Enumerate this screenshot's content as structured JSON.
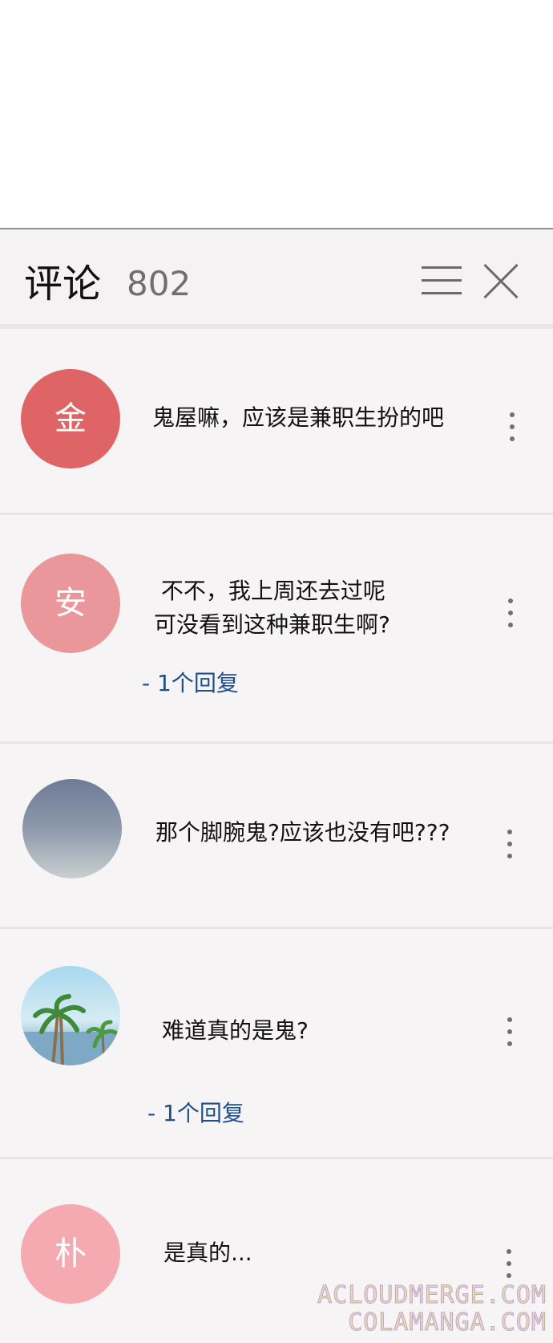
{
  "header": {
    "title": "评论",
    "count": "802"
  },
  "comments": [
    {
      "avatar_text": "金",
      "avatar_color": "#df6466",
      "text": "鬼屋嘛，应该是兼职生扮的吧",
      "reply": ""
    },
    {
      "avatar_text": "安",
      "avatar_color": "#e9979a",
      "text": " 不不，我上周还去过呢\n可没看到这种兼职生啊?",
      "reply": "- 1个回复"
    },
    {
      "avatar_text": "",
      "avatar_color": "#8f9cb2",
      "text": "那个脚腕鬼?应该也没有吧???",
      "reply": ""
    },
    {
      "avatar_text": "",
      "avatar_color": "#9ed0ea",
      "text": "难道真的是鬼?",
      "reply": "-  1个回复"
    },
    {
      "avatar_text": "朴",
      "avatar_color": "#f5a9b1",
      "text": "是真的...",
      "reply": ""
    }
  ],
  "watermark": {
    "line1": "ACLOUDMERGE.COM",
    "line2": "COLAMANGA.COM"
  },
  "icons": {
    "menu": "menu-icon",
    "close": "close-icon",
    "more": "more-vertical-icon"
  }
}
